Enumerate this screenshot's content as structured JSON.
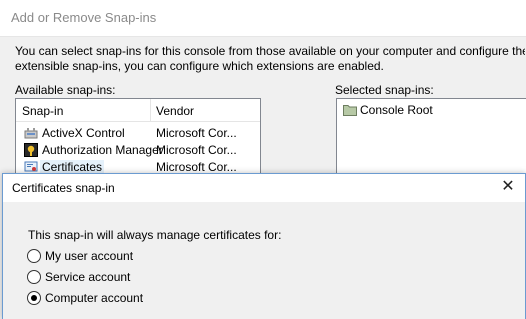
{
  "background_dialog": {
    "title": "Add or Remove Snap-ins",
    "description_line1": "You can select snap-ins for this console from those available on your computer and configure the selected",
    "description_line2": "extensible snap-ins, you can configure which extensions are enabled.",
    "available_label": "Available snap-ins:",
    "selected_label": "Selected snap-ins:",
    "columns": {
      "snapin": "Snap-in",
      "vendor": "Vendor"
    },
    "available_items": [
      {
        "name": "ActiveX Control",
        "vendor": "Microsoft Cor...",
        "icon": "activex-control-icon"
      },
      {
        "name": "Authorization Manager",
        "vendor": "Microsoft Cor...",
        "icon": "authorization-manager-icon"
      },
      {
        "name": "Certificates",
        "vendor": "Microsoft Cor...",
        "icon": "certificates-icon",
        "selected": true
      }
    ],
    "selected_items": [
      {
        "name": "Console Root",
        "icon": "folder-icon"
      }
    ]
  },
  "certificates_dialog": {
    "title": "Certificates snap-in",
    "close_glyph": "✕",
    "intro": "This snap-in will always manage certificates for:",
    "options": [
      {
        "label": "My user account",
        "checked": false
      },
      {
        "label": "Service account",
        "checked": false
      },
      {
        "label": "Computer account",
        "checked": true
      }
    ]
  }
}
